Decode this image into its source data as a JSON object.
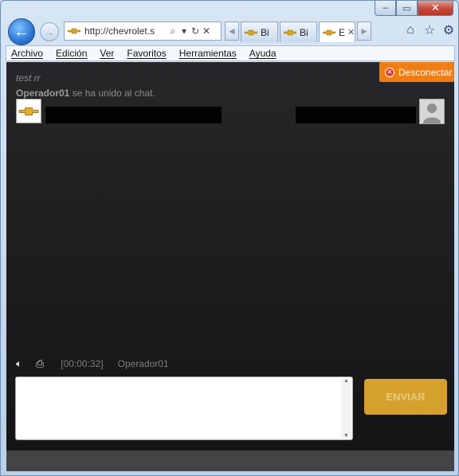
{
  "browser": {
    "caption": {
      "minimize": "–",
      "maximize": "▭",
      "close": "✕"
    },
    "address": {
      "url": "http://chevrolet.s"
    },
    "tabs": [
      {
        "label": "Bi",
        "active": false
      },
      {
        "label": "Bi",
        "active": false
      },
      {
        "label": "E",
        "active": true
      }
    ],
    "menu": [
      "Archivo",
      "Edición",
      "Ver",
      "Favoritos",
      "Herramientas",
      "Ayuda"
    ]
  },
  "chat": {
    "disconnect_label": "Desconectar",
    "title": "test rr",
    "join_operator": "Operador01",
    "join_text": " se ha unido al chat.",
    "timer": "[00:00:32]",
    "operator_name": "Operador01",
    "message_value": "",
    "send_label": "ENVIAR"
  },
  "colors": {
    "accent_orange": "#f07e12",
    "send_gold": "#d5a12c",
    "chat_bg": "#1e1e20"
  }
}
